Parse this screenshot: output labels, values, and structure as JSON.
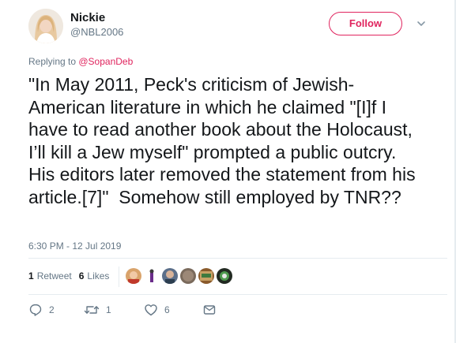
{
  "user": {
    "name": "Nickie",
    "handle": "@NBL2006"
  },
  "follow_label": "Follow",
  "reply": {
    "prefix": "Replying to ",
    "mention": "@SopanDeb"
  },
  "tweet_text": "\"In May 2011, Peck's criticism of Jewish-American literature in which he claimed \"[I]f I have to read another book about the Holocaust, I’ll kill a Jew myself\" prompted a public outcry. His editors later removed the statement from his article.[7]\"  Somehow still employed by TNR??",
  "timestamp": "6:30 PM - 12 Jul 2019",
  "stats": {
    "retweets_count": "1",
    "retweets_label": "Retweet",
    "likes_count": "6",
    "likes_label": "Likes"
  },
  "actions": {
    "reply_count": "2",
    "retweet_count": "1",
    "like_count": "6"
  },
  "colors": {
    "accent": "#e0245e",
    "secondary_text": "#657786",
    "divider": "#e6ecf0"
  },
  "icons": [
    "chevron-down-icon",
    "reply-icon",
    "retweet-icon",
    "like-icon",
    "direct-message-icon"
  ]
}
